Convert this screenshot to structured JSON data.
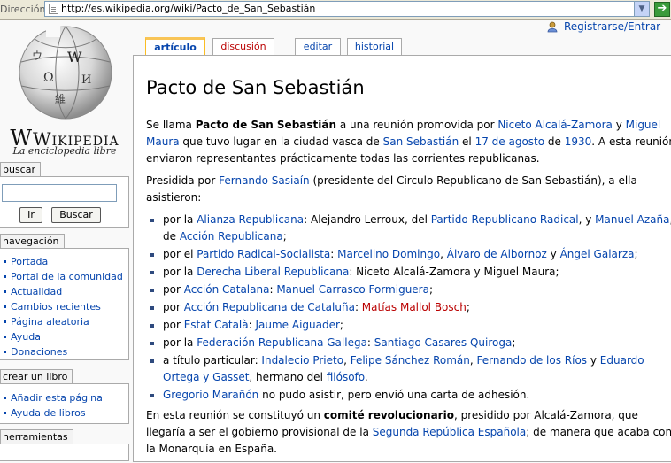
{
  "browser": {
    "address_label": "Dirección",
    "url": "http://es.wikipedia.org/wiki/Pacto_de_San_Sebastián",
    "go_icon": "green-arrow-icon"
  },
  "logo": {
    "wordmark": "Wikipedia",
    "tagline": "La enciclopedia libre"
  },
  "user": {
    "login_label": "Registrarse/Entrar"
  },
  "tabs": [
    {
      "label": "artículo",
      "selected": true
    },
    {
      "label": "discusión",
      "new": true
    },
    {
      "label": "editar"
    },
    {
      "label": "historial"
    }
  ],
  "sidebar": {
    "search": {
      "title": "buscar",
      "go_label": "Ir",
      "search_label": "Buscar"
    },
    "navigation": {
      "title": "navegación",
      "items": [
        "Portada",
        "Portal de la comunidad",
        "Actualidad",
        "Cambios recientes",
        "Página aleatoria",
        "Ayuda",
        "Donaciones"
      ]
    },
    "book": {
      "title": "crear un libro",
      "items": [
        "Añadir esta página",
        "Ayuda de libros"
      ]
    },
    "tools": {
      "title": "herramientas"
    }
  },
  "article": {
    "title": "Pacto de San Sebastián",
    "p1": {
      "t1": "Se llama ",
      "b1": "Pacto de San Sebastián",
      "t2": " a una reunión promovida por ",
      "l1": "Niceto Alcalá-Zamora",
      "t3": " y ",
      "l2": "Miguel Maura",
      "t4": " que tuvo lugar en la ciudad vasca de ",
      "l3": "San Sebastián",
      "t5": " el ",
      "l4": "17 de agosto",
      "t6": " de ",
      "l5": "1930",
      "t7": ". A esta reunión enviaron representantes prácticamente todas las corrientes republicanas."
    },
    "p2": {
      "t1": "Presidida por ",
      "l1": "Fernando Sasiaín",
      "t2": " (presidente del Circulo Republicano de San Sebastián), a ella asistieron:"
    },
    "list": {
      "i1": {
        "t1": "por la ",
        "l1": "Alianza Republicana",
        "t2": ": Alejandro Lerroux, del ",
        "l2": "Partido Republicano Radical",
        "t3": ", y ",
        "l3": "Manuel Azaña",
        "t4": ", de ",
        "l4": "Acción Republicana",
        "t5": ";"
      },
      "i2": {
        "t1": "por el ",
        "l1": "Partido Radical-Socialista",
        "t2": ": ",
        "l2": "Marcelino Domingo",
        "t3": ", ",
        "l3": "Álvaro de Albornoz",
        "t4": " y ",
        "l4": "Ángel Galarza",
        "t5": ";"
      },
      "i3": {
        "t1": "por la ",
        "l1": "Derecha Liberal Republicana",
        "t2": ": Niceto Alcalá-Zamora y Miguel Maura;"
      },
      "i4": {
        "t1": "por ",
        "l1": "Acción Catalana",
        "t2": ": ",
        "l2": "Manuel Carrasco Formiguera",
        "t3": ";"
      },
      "i5": {
        "t1": "por ",
        "l1": "Acción Republicana de Cataluña",
        "t2": ": ",
        "n1": "Matías Mallol Bosch",
        "t3": ";"
      },
      "i6": {
        "t1": "por ",
        "l1": "Estat Català",
        "t2": ": ",
        "l2": "Jaume Aiguader",
        "t3": ";"
      },
      "i7": {
        "t1": "por la ",
        "l1": "Federación Republicana Gallega",
        "t2": ": ",
        "l2": "Santiago Casares Quiroga",
        "t3": ";"
      },
      "i8": {
        "t1": "a título particular: ",
        "l1": "Indalecio Prieto",
        "t2": ", ",
        "l2": "Felipe Sánchez Román",
        "t3": ", ",
        "l3": "Fernando de los Ríos",
        "t4": " y ",
        "l4": "Eduardo Ortega y Gasset",
        "t5": ", hermano del ",
        "l5": "filósofo",
        "t6": "."
      },
      "i9": {
        "l1": "Gregorio Marañón",
        "t1": " no pudo asistir, pero envió una carta de adhesión."
      }
    },
    "p3": {
      "t1": "En esta reunión se constituyó un ",
      "b1": "comité revolucionario",
      "t2": ", presidido por Alcalá-Zamora, que llegaría a ser el gobierno provisional de la ",
      "l1": "Segunda República Española",
      "t3": "; de manera que acaba con la Monarquía en España."
    }
  }
}
